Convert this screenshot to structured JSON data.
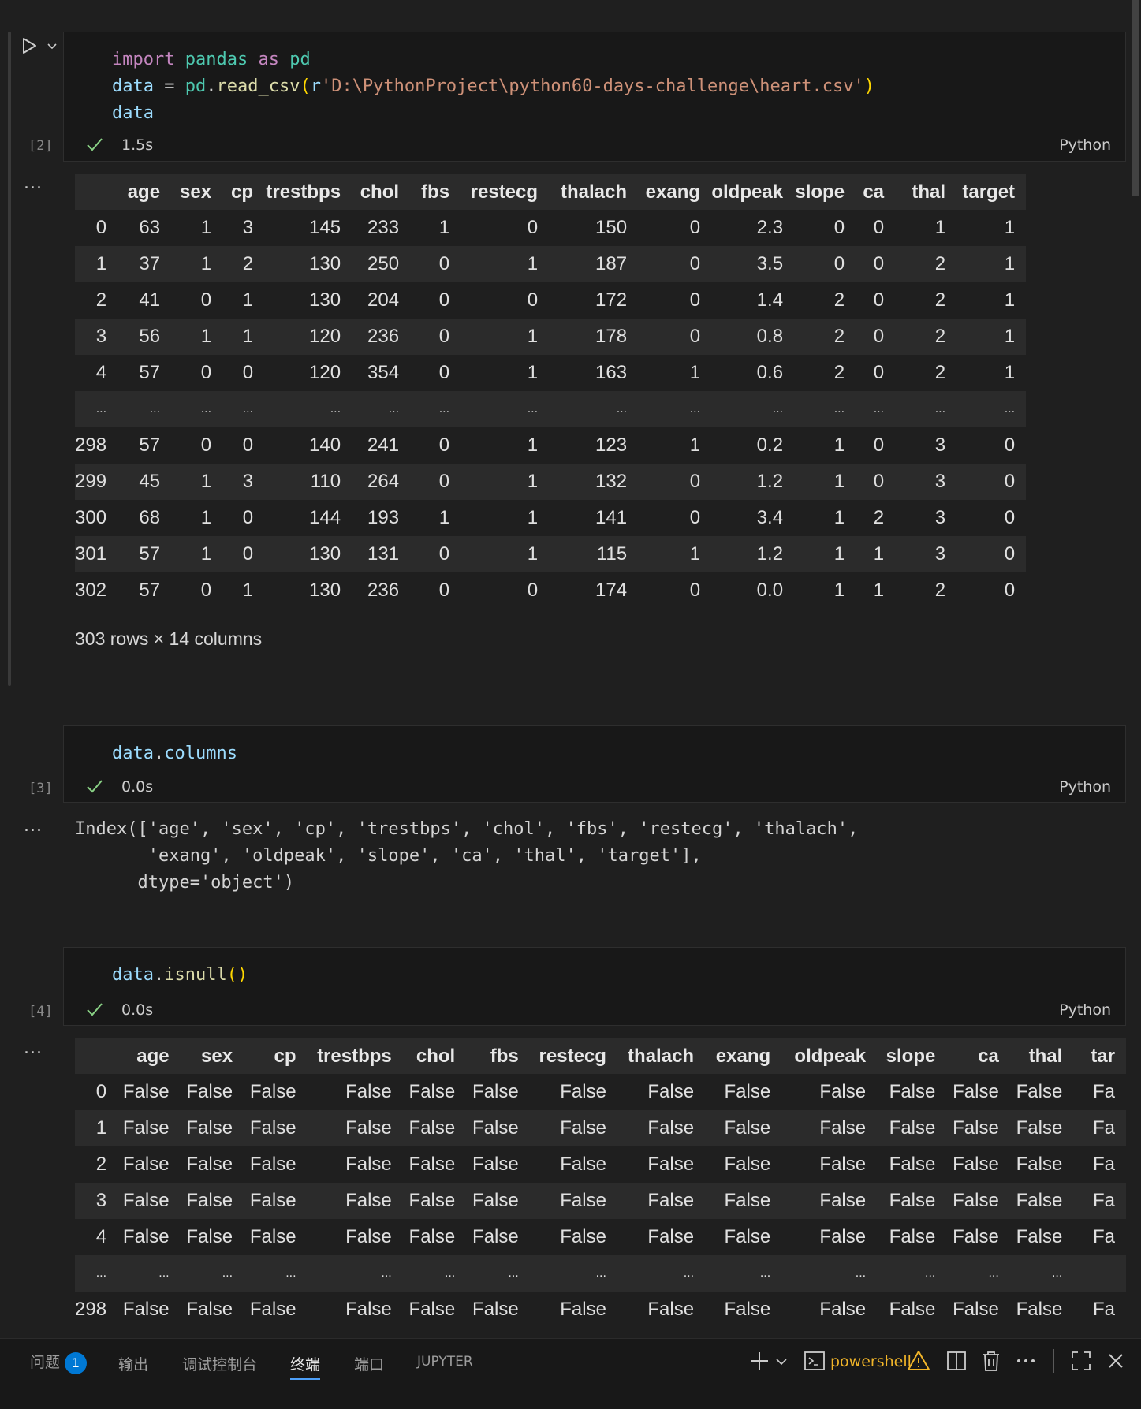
{
  "cells": [
    {
      "exec_count": "[2]",
      "duration": "1.5s",
      "language": "Python",
      "code": {
        "line1": {
          "kw1": "import",
          "mod": "pandas",
          "kw2": "as",
          "alias": "pd"
        },
        "line2": {
          "var": "data",
          "eq": " = ",
          "obj": "pd",
          "dot": ".",
          "fn": "read_csv",
          "open": "(",
          "prefix": "r",
          "str": "'D:\\PythonProject\\python60-days-challenge\\heart.csv'",
          "close": ")"
        },
        "line3": "data"
      },
      "output_dots": "...",
      "table": {
        "columns": [
          "",
          "age",
          "sex",
          "cp",
          "trestbps",
          "chol",
          "fbs",
          "restecg",
          "thalach",
          "exang",
          "oldpeak",
          "slope",
          "ca",
          "thal",
          "target"
        ],
        "rows": [
          [
            "0",
            "63",
            "1",
            "3",
            "145",
            "233",
            "1",
            "0",
            "150",
            "0",
            "2.3",
            "0",
            "0",
            "1",
            "1"
          ],
          [
            "1",
            "37",
            "1",
            "2",
            "130",
            "250",
            "0",
            "1",
            "187",
            "0",
            "3.5",
            "0",
            "0",
            "2",
            "1"
          ],
          [
            "2",
            "41",
            "0",
            "1",
            "130",
            "204",
            "0",
            "0",
            "172",
            "0",
            "1.4",
            "2",
            "0",
            "2",
            "1"
          ],
          [
            "3",
            "56",
            "1",
            "1",
            "120",
            "236",
            "0",
            "1",
            "178",
            "0",
            "0.8",
            "2",
            "0",
            "2",
            "1"
          ],
          [
            "4",
            "57",
            "0",
            "0",
            "120",
            "354",
            "0",
            "1",
            "163",
            "1",
            "0.6",
            "2",
            "0",
            "2",
            "1"
          ],
          [
            "...",
            "...",
            "...",
            "...",
            "...",
            "...",
            "...",
            "...",
            "...",
            "...",
            "...",
            "...",
            "...",
            "...",
            "..."
          ],
          [
            "298",
            "57",
            "0",
            "0",
            "140",
            "241",
            "0",
            "1",
            "123",
            "1",
            "0.2",
            "1",
            "0",
            "3",
            "0"
          ],
          [
            "299",
            "45",
            "1",
            "3",
            "110",
            "264",
            "0",
            "1",
            "132",
            "0",
            "1.2",
            "1",
            "0",
            "3",
            "0"
          ],
          [
            "300",
            "68",
            "1",
            "0",
            "144",
            "193",
            "1",
            "1",
            "141",
            "0",
            "3.4",
            "1",
            "2",
            "3",
            "0"
          ],
          [
            "301",
            "57",
            "1",
            "0",
            "130",
            "131",
            "0",
            "1",
            "115",
            "1",
            "1.2",
            "1",
            "1",
            "3",
            "0"
          ],
          [
            "302",
            "57",
            "0",
            "1",
            "130",
            "236",
            "0",
            "0",
            "174",
            "0",
            "0.0",
            "1",
            "1",
            "2",
            "0"
          ]
        ],
        "shape": "303 rows × 14 columns"
      }
    },
    {
      "exec_count": "[3]",
      "duration": "0.0s",
      "language": "Python",
      "code": {
        "var": "data",
        "dot": ".",
        "attr": "columns"
      },
      "output_dots": "...",
      "output_text": [
        "Index(['age', 'sex', 'cp', 'trestbps', 'chol', 'fbs', 'restecg', 'thalach',",
        "       'exang', 'oldpeak', 'slope', 'ca', 'thal', 'target'],",
        "      dtype='object')"
      ]
    },
    {
      "exec_count": "[4]",
      "duration": "0.0s",
      "language": "Python",
      "code": {
        "var": "data",
        "dot": ".",
        "fn": "isnull",
        "parens": "()"
      },
      "output_dots": "...",
      "table": {
        "columns": [
          "",
          "age",
          "sex",
          "cp",
          "trestbps",
          "chol",
          "fbs",
          "restecg",
          "thalach",
          "exang",
          "oldpeak",
          "slope",
          "ca",
          "thal",
          "tar"
        ],
        "rows": [
          [
            "0",
            "False",
            "False",
            "False",
            "False",
            "False",
            "False",
            "False",
            "False",
            "False",
            "False",
            "False",
            "False",
            "False",
            "Fa"
          ],
          [
            "1",
            "False",
            "False",
            "False",
            "False",
            "False",
            "False",
            "False",
            "False",
            "False",
            "False",
            "False",
            "False",
            "False",
            "Fa"
          ],
          [
            "2",
            "False",
            "False",
            "False",
            "False",
            "False",
            "False",
            "False",
            "False",
            "False",
            "False",
            "False",
            "False",
            "False",
            "Fa"
          ],
          [
            "3",
            "False",
            "False",
            "False",
            "False",
            "False",
            "False",
            "False",
            "False",
            "False",
            "False",
            "False",
            "False",
            "False",
            "Fa"
          ],
          [
            "4",
            "False",
            "False",
            "False",
            "False",
            "False",
            "False",
            "False",
            "False",
            "False",
            "False",
            "False",
            "False",
            "False",
            "Fa"
          ],
          [
            "...",
            "...",
            "...",
            "...",
            "...",
            "...",
            "...",
            "...",
            "...",
            "...",
            "...",
            "...",
            "...",
            "...",
            ""
          ],
          [
            "298",
            "False",
            "False",
            "False",
            "False",
            "False",
            "False",
            "False",
            "False",
            "False",
            "False",
            "False",
            "False",
            "False",
            "Fa"
          ]
        ]
      }
    }
  ],
  "panel": {
    "tabs": [
      {
        "label": "问题",
        "badge": "1"
      },
      {
        "label": "输出"
      },
      {
        "label": "调试控制台"
      },
      {
        "label": "终端",
        "active": true
      },
      {
        "label": "端口"
      },
      {
        "label": "JUPYTER"
      }
    ],
    "shell": "powershell",
    "icons": [
      "plus-icon",
      "chevron-down-icon",
      "terminal-icon",
      "warning-icon",
      "split-icon",
      "trash-icon",
      "more-icon",
      "maximize-icon",
      "close-icon"
    ]
  },
  "colors": {
    "background": "#1f1f1f",
    "cell_background": "#181818",
    "check": "#89d185",
    "accent": "#0078d4",
    "warning": "#f0b429"
  }
}
